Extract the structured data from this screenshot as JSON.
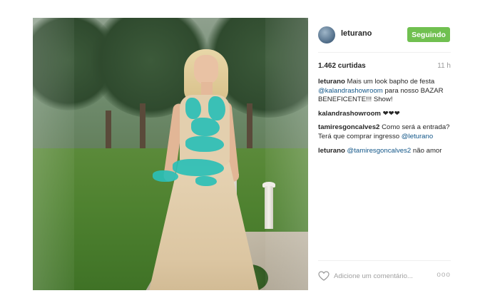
{
  "post": {
    "photo_icon": "photo-of-woman-in-lace-gown"
  },
  "header": {
    "username": "leturano",
    "follow_label": "Seguindo",
    "follow_color": "#70c050"
  },
  "stats": {
    "likes": "1.462 curtidas",
    "time": "11 h"
  },
  "comments": [
    {
      "user": "leturano",
      "text_parts": [
        "Mais um look bapho de festa ",
        "@kalandrashowroom",
        " para nosso BAZAR BENEFICENTE!!! Show!"
      ]
    },
    {
      "user": "kalandrashowroom",
      "text_parts": [
        "❤❤❤"
      ]
    },
    {
      "user": "tamiresgoncalves2",
      "text_parts": [
        "Como será a entrada? Terá que comprar ingresso ",
        "@leturano"
      ]
    },
    {
      "user": "leturano",
      "text_parts": [
        "",
        "@tamiresgoncalves2",
        " não amor"
      ]
    }
  ],
  "footer": {
    "comment_placeholder": "Adicione um comentário...",
    "more_label": "ooo",
    "heart_icon": "heart-icon"
  },
  "colors": {
    "mention": "#125688",
    "lace": "#2bbfb6"
  }
}
